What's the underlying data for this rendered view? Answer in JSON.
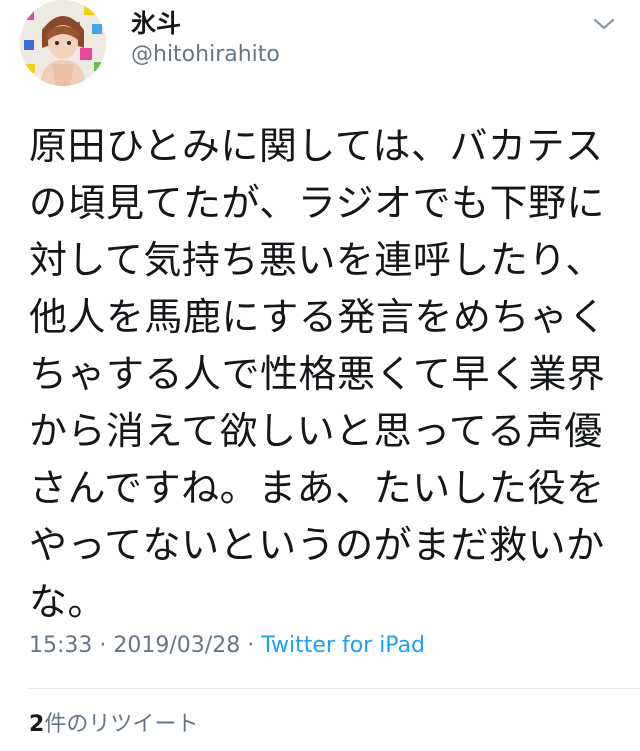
{
  "tweet": {
    "author": {
      "display_name": "氷斗",
      "handle": "@hitohirahito"
    },
    "text_lines": [
      "原田ひとみに関しては、バカテス",
      "の頃見てたが、ラジオでも下野に",
      "対して気持ち悪いを連呼したり、",
      "他人を馬鹿にする発言をめちゃく",
      "ちゃする人で性格悪くて早く業界",
      "から消えて欲しいと思ってる声優",
      "さんですね。まあ、たいした役を",
      "やってないというのがまだ救いか",
      "な。"
    ],
    "time": "15:33",
    "separator": "·",
    "date": "2019/03/28",
    "source": "Twitter for iPad",
    "retweet_count": "2",
    "retweet_label": "件のリツイート"
  },
  "colors": {
    "text": "#14171a",
    "secondary": "#657786",
    "link": "#1da1f2",
    "divider": "#e1e8ed"
  },
  "icons": {
    "menu": "chevron-down-icon",
    "avatar": "avatar"
  }
}
